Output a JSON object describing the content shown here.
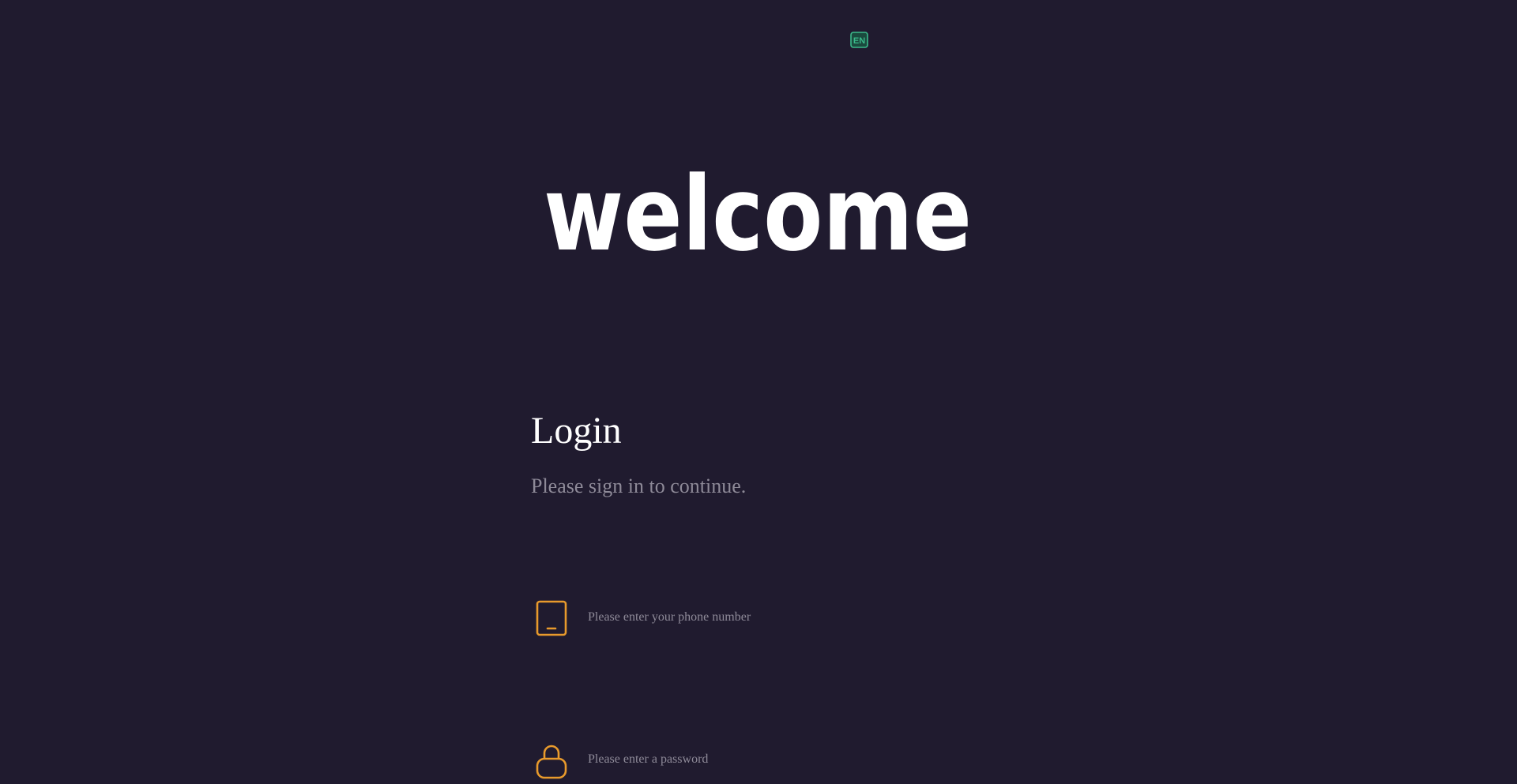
{
  "language_button": {
    "label": "EN",
    "color": "#3bb98a"
  },
  "hero": {
    "title": "welcome"
  },
  "login": {
    "title": "Login",
    "subtitle": "Please sign in to continue."
  },
  "fields": {
    "phone": {
      "icon": "tablet-icon",
      "value": "",
      "placeholder": "Please enter your phone number"
    },
    "password": {
      "icon": "lock-icon",
      "value": "",
      "placeholder": "Please enter a password"
    }
  },
  "colors": {
    "background": "#201b2f",
    "accent": "#e89a2c",
    "muted_text": "#8e8a98",
    "language_accent": "#3bb98a"
  }
}
